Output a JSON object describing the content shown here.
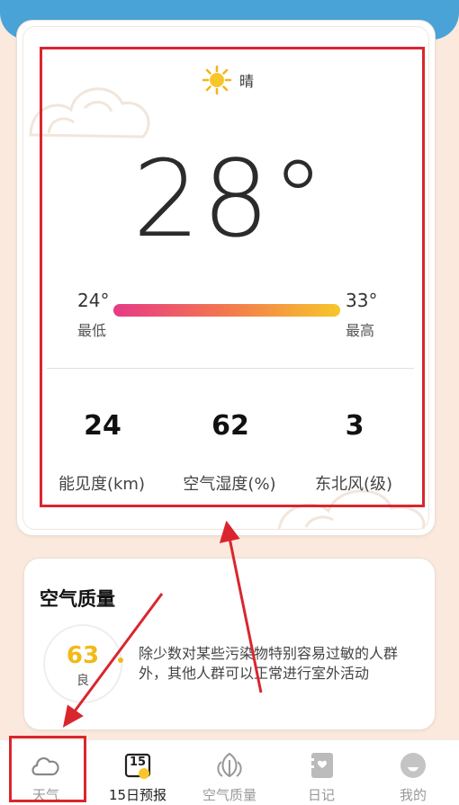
{
  "weather": {
    "condition": "晴",
    "condition_icon": "sun-icon",
    "temperature": "28°",
    "low": {
      "value": "24°",
      "label": "最低"
    },
    "high": {
      "value": "33°",
      "label": "最高"
    },
    "stats": [
      {
        "value": "24",
        "label": "能见度(km)"
      },
      {
        "value": "62",
        "label": "空气湿度(%)"
      },
      {
        "value": "3",
        "label": "东北风(级)"
      }
    ]
  },
  "air_quality": {
    "title": "空气质量",
    "aqi": "63",
    "grade": "良",
    "description": "除少数对某些污染物特别容易过敏的人群外，其他人群可以正常进行室外活动"
  },
  "nav": {
    "items": [
      {
        "label": "天气",
        "icon": "cloud-icon"
      },
      {
        "label": "15日预报",
        "icon": "calendar-icon",
        "badge": "15"
      },
      {
        "label": "空气质量",
        "icon": "leaf-icon"
      },
      {
        "label": "日记",
        "icon": "diary-icon"
      },
      {
        "label": "我的",
        "icon": "profile-icon"
      }
    ]
  },
  "colors": {
    "header": "#4aa3d6",
    "background": "#fbe9dd",
    "highlight": "#d9262e",
    "aqi": "#f3b917",
    "gradient_start": "#e63a86",
    "gradient_end": "#f7c62b"
  }
}
